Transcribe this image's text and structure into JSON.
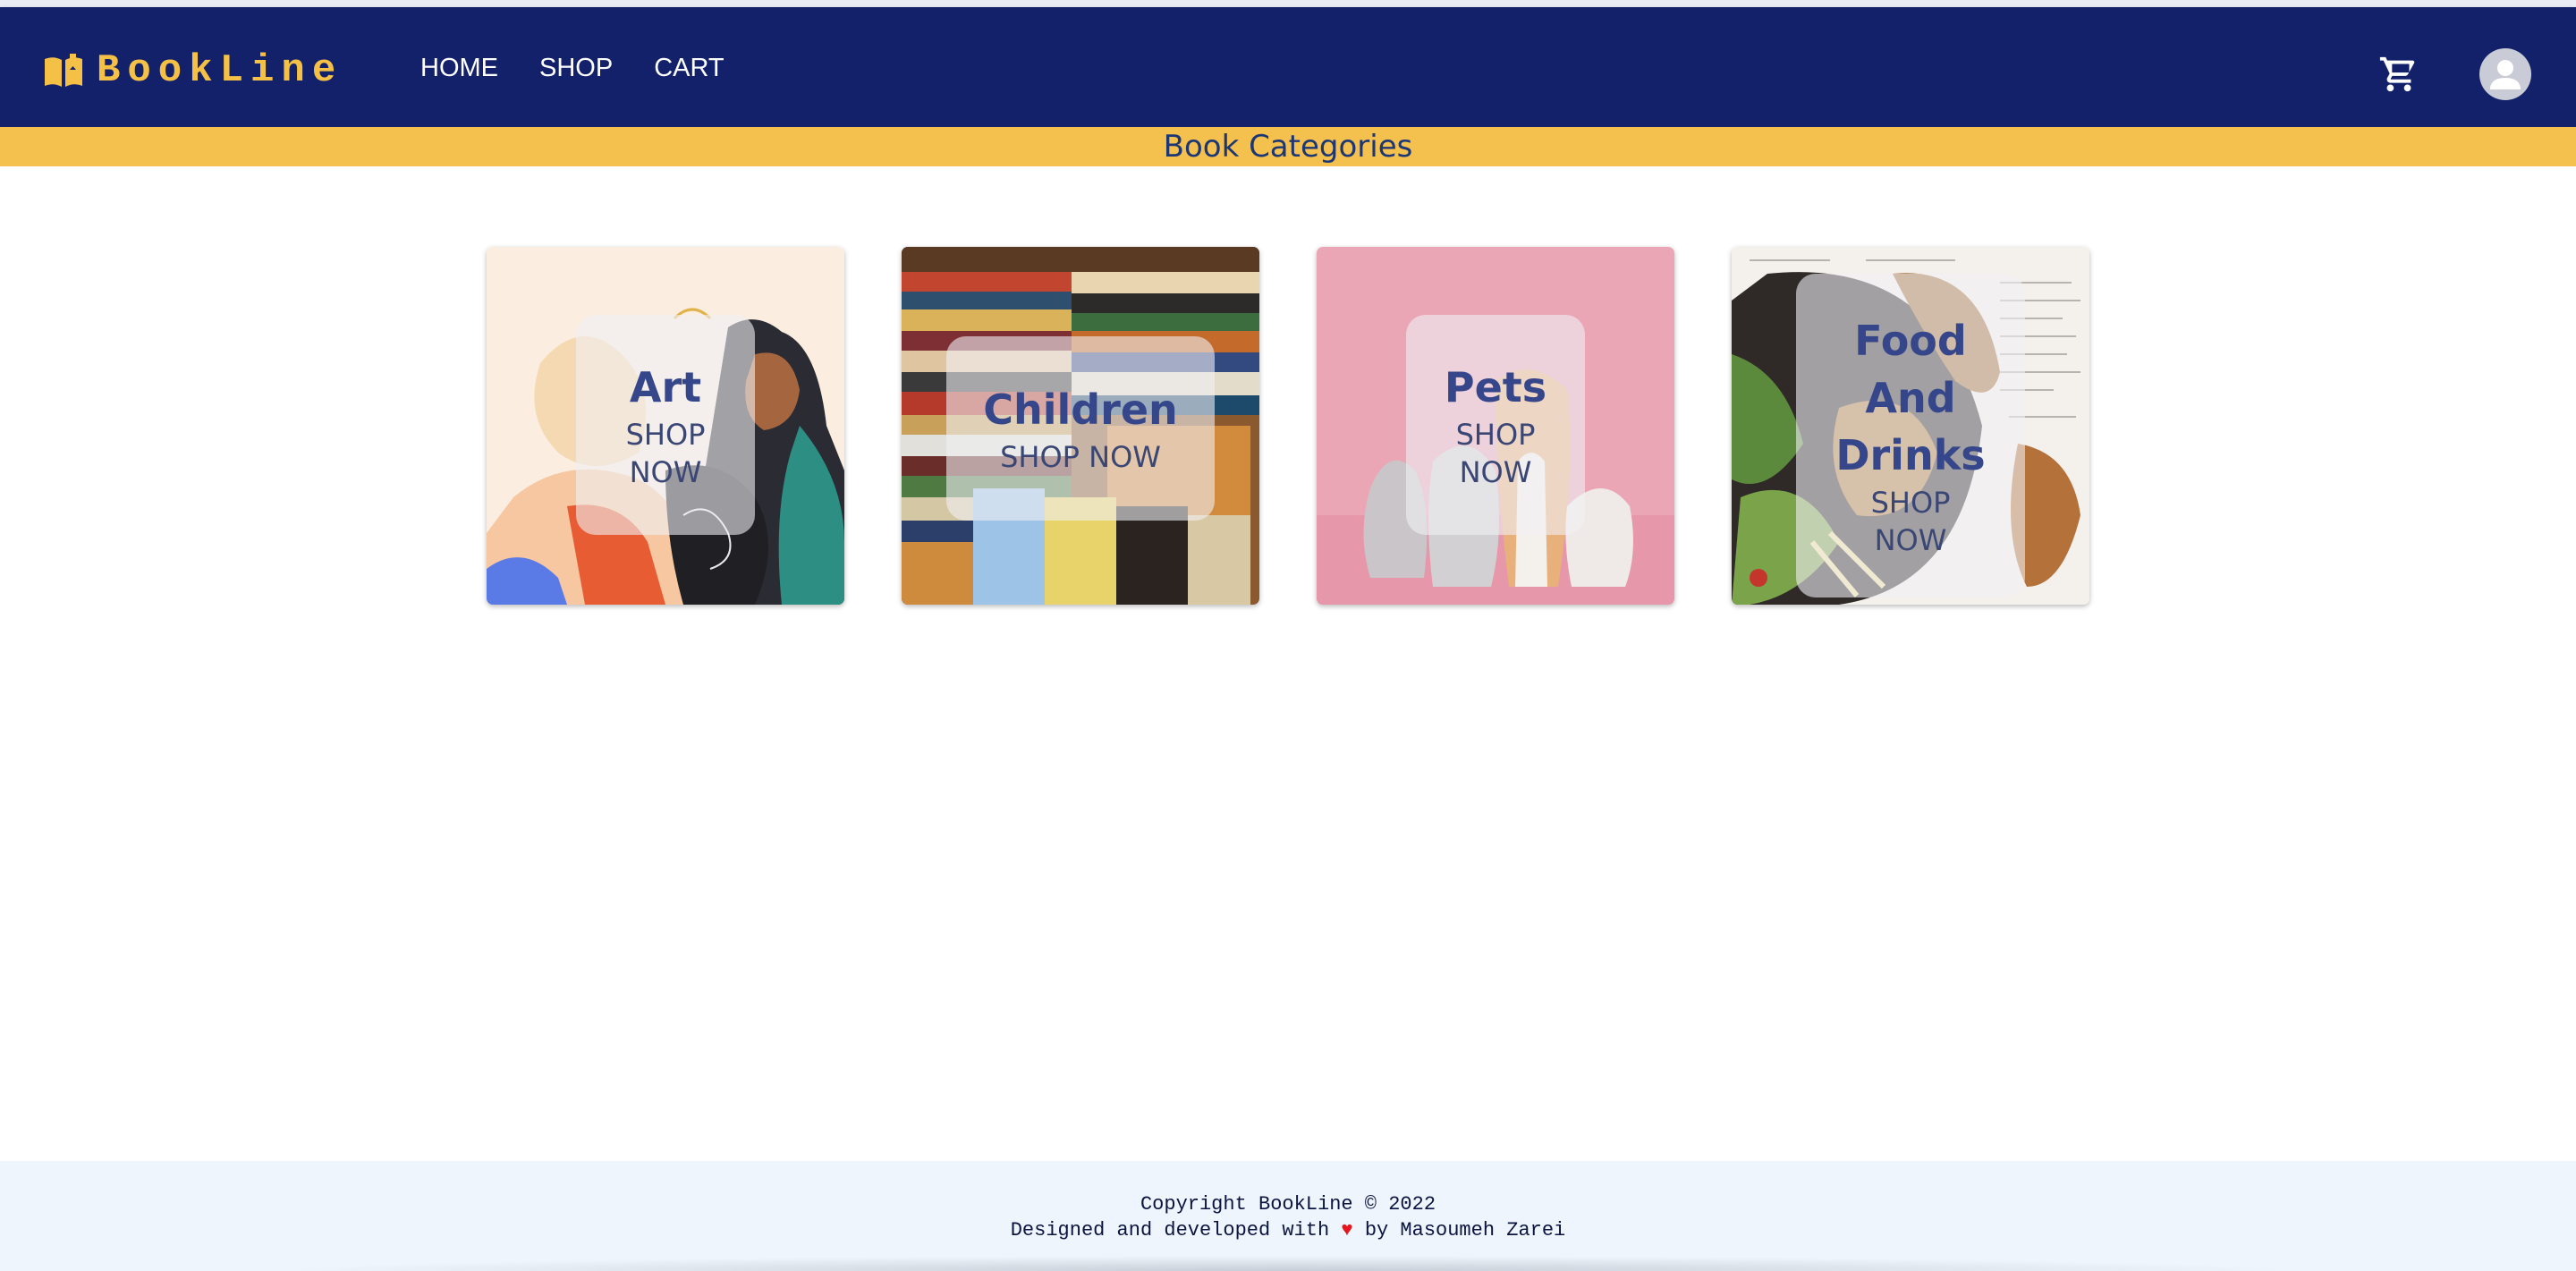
{
  "brand": {
    "name": "BookLine",
    "logo_icon": "open-book-icon",
    "accent": "#f4c046",
    "nav_bg": "#13216a"
  },
  "nav": {
    "links": [
      "HOME",
      "SHOP",
      "CART"
    ]
  },
  "header_icons": {
    "cart": "shopping-cart-icon",
    "account": "user-avatar-icon"
  },
  "banner": {
    "title": "Book Categories",
    "bg": "#f4c04e"
  },
  "categories": [
    {
      "title": "Art",
      "cta": "SHOP NOW"
    },
    {
      "title": "Children",
      "cta": "SHOP NOW"
    },
    {
      "title": "Pets",
      "cta": "SHOP NOW"
    },
    {
      "title": "Food And Drinks",
      "cta": "SHOP NOW"
    }
  ],
  "footer": {
    "copyright": "Copyright BookLine © 2022",
    "credit_before": "Designed and developed with",
    "credit_heart": "♥",
    "credit_after": "by Masoumeh Zarei"
  }
}
